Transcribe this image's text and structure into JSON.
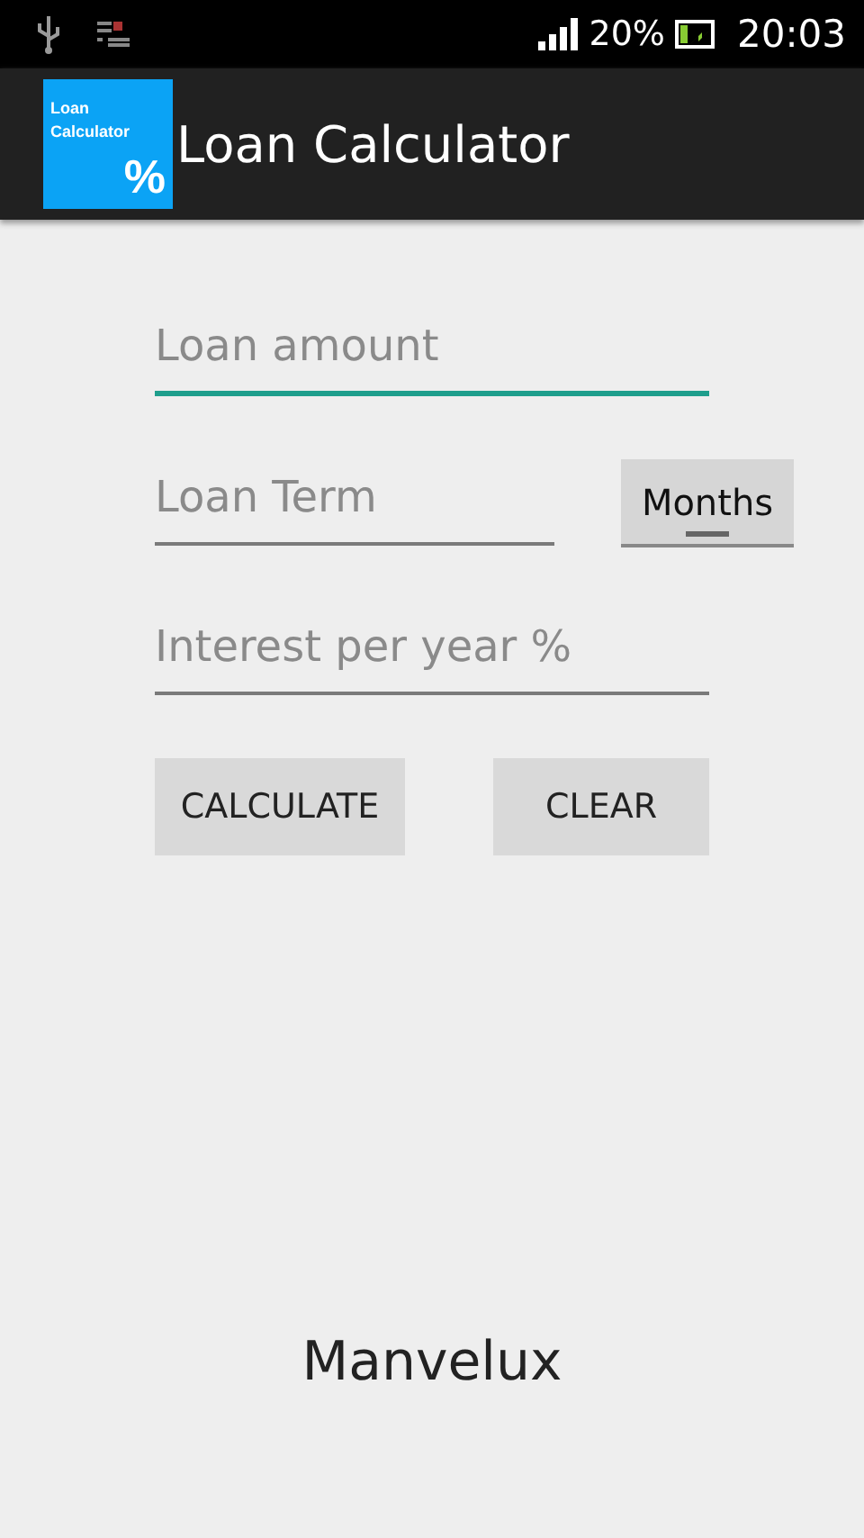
{
  "status_bar": {
    "battery": "20%",
    "time": "20:03"
  },
  "app_bar": {
    "logo_line_1": "Loan",
    "logo_line_2": "Calculator",
    "logo_symbol": "%",
    "title": "Loan Calculator"
  },
  "fields": [
    {
      "placeholder": "Loan amount",
      "focused": true
    },
    {
      "placeholder": "Loan Term",
      "focused": false
    },
    {
      "placeholder": "Interest per year %",
      "focused": false
    }
  ],
  "term_unit": "Months",
  "buttons": [
    "CALCULATE",
    "CLEAR"
  ],
  "footer": "Manvelux"
}
